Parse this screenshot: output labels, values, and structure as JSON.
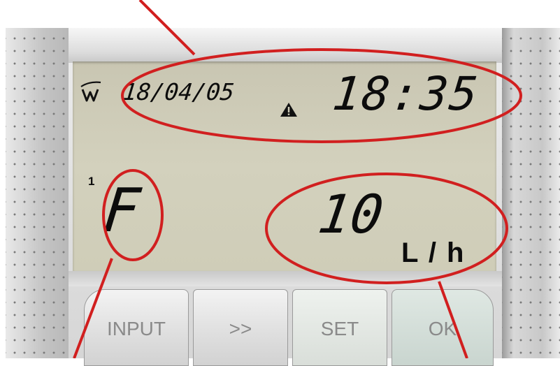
{
  "display": {
    "date": "18/04/05",
    "time": "18:35",
    "channel": "1",
    "mode": "F",
    "flow_value": "10",
    "flow_unit": "L / h"
  },
  "icons": {
    "logo": "w-logo-icon",
    "warning": "warning-triangle-icon"
  },
  "buttons": {
    "input_label": "INPUT",
    "next_label": ">>",
    "set_label": "SET",
    "ok_label": "OK"
  },
  "colors": {
    "annotation": "#d11f1f",
    "lcd_background": "#cfccb8",
    "lcd_segments": "#0c0c0c"
  }
}
